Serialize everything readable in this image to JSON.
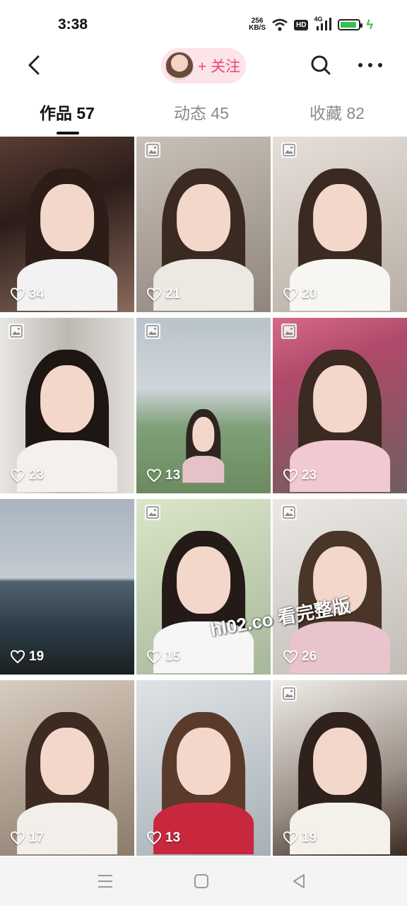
{
  "status_bar": {
    "time": "3:38",
    "net_speed_value": "256",
    "net_speed_unit": "KB/S",
    "hd": "HD",
    "network": "4G",
    "battery_level": 0.9,
    "icons": [
      "wifi-icon",
      "signal-icon",
      "battery-icon",
      "charging-icon"
    ]
  },
  "header": {
    "follow_label": "+ 关注",
    "icons": [
      "back-icon",
      "search-icon",
      "more-icon"
    ]
  },
  "tabs": [
    {
      "label": "作品 57",
      "active": true
    },
    {
      "label": "动态 45",
      "active": false
    },
    {
      "label": "收藏 82",
      "active": false
    }
  ],
  "colors": {
    "accent": "#f0436b",
    "pill_bg": "#fde3ea"
  },
  "posts": [
    {
      "likes": "34",
      "image_badge": false
    },
    {
      "likes": "21",
      "image_badge": true
    },
    {
      "likes": "20",
      "image_badge": true
    },
    {
      "likes": "23",
      "image_badge": true
    },
    {
      "likes": "13",
      "image_badge": true
    },
    {
      "likes": "23",
      "image_badge": true
    },
    {
      "likes": "19",
      "image_badge": false
    },
    {
      "likes": "15",
      "image_badge": true
    },
    {
      "likes": "26",
      "image_badge": true
    },
    {
      "likes": "17",
      "image_badge": false
    },
    {
      "likes": "13",
      "image_badge": false
    },
    {
      "likes": "19",
      "image_badge": true
    }
  ],
  "watermark": "hl02.co 看完整版",
  "nav_bar": {
    "icons": [
      "menu-icon",
      "home-icon",
      "back-triangle-icon"
    ]
  }
}
